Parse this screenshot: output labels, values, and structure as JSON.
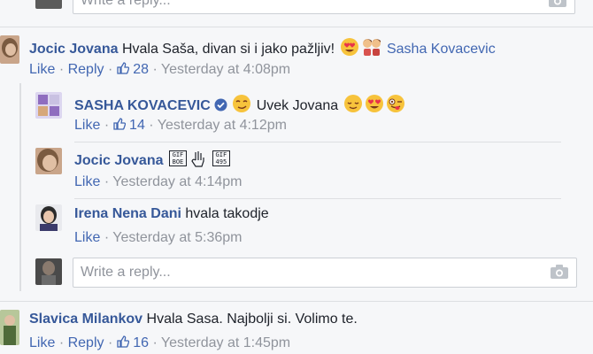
{
  "top_reply": {
    "placeholder": "Write a reply..."
  },
  "comments": [
    {
      "author": "Jocic Jovana",
      "text": "Hvala Saša, divan si i jako pažljiv!",
      "mention": "Sasha Kovacevic",
      "like_label": "Like",
      "reply_label": "Reply",
      "likes": "28",
      "time": "Yesterday at 4:08pm"
    },
    {
      "author": "SASHA KOVACEVIC",
      "text": "Uvek Jovana",
      "like_label": "Like",
      "likes": "14",
      "time": "Yesterday at 4:12pm"
    },
    {
      "author": "Jocic Jovana",
      "text": "",
      "like_label": "Like",
      "time": "Yesterday at 4:14pm"
    },
    {
      "author": "Irena Nena Dani",
      "text": "hvala takodje",
      "like_label": "Like",
      "time": "Yesterday at 5:36pm"
    },
    {
      "author": "Slavica Milankov",
      "text": "Hvala Sasa. Najbolji si. Volimo te.",
      "like_label": "Like",
      "reply_label": "Reply",
      "likes": "16",
      "time": "Yesterday at 1:45pm"
    }
  ],
  "nested_reply": {
    "placeholder": "Write a reply..."
  },
  "separator": "·",
  "icons": {
    "like": "thumbs-up-icon",
    "camera": "camera-icon",
    "verified": "verified-badge-icon",
    "gif": "gif-icon"
  },
  "colors": {
    "link": "#4267b2",
    "name": "#365899",
    "meta": "#90949c",
    "background": "#f6f7f9"
  }
}
